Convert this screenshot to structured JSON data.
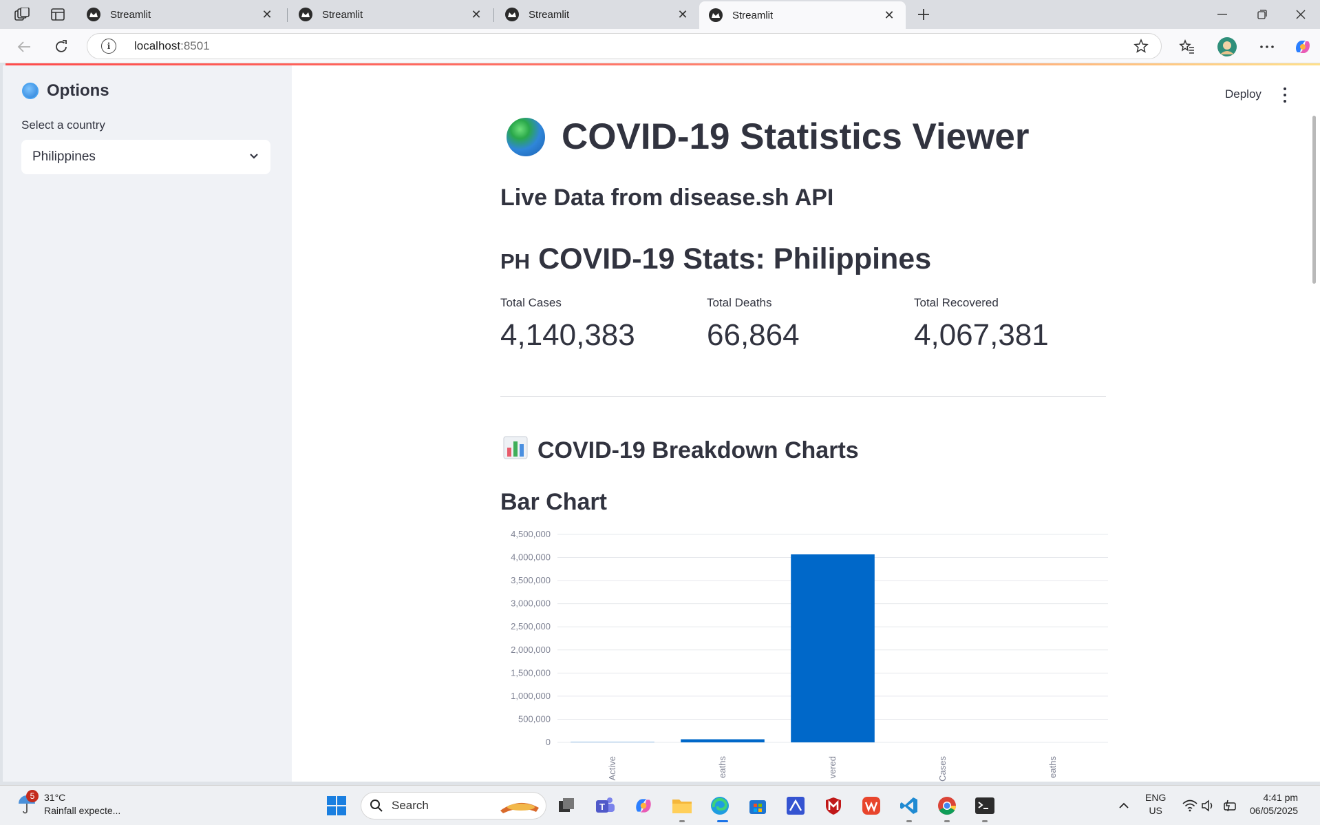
{
  "browser": {
    "tabs": [
      {
        "title": "Streamlit",
        "active": false
      },
      {
        "title": "Streamlit",
        "active": false
      },
      {
        "title": "Streamlit",
        "active": false
      },
      {
        "title": "Streamlit",
        "active": true
      }
    ],
    "url_host": "localhost",
    "url_port": ":8501"
  },
  "sidebar": {
    "title": "Options",
    "select_label": "Select a country",
    "select_value": "Philippines"
  },
  "header": {
    "deploy_label": "Deploy"
  },
  "main": {
    "title": "COVID-19 Statistics Viewer",
    "subtitle": "Live Data from disease.sh API",
    "stats_flag": "PH",
    "stats_heading": "COVID-19 Stats: Philippines",
    "metrics": [
      {
        "label": "Total Cases",
        "value": "4,140,383"
      },
      {
        "label": "Total Deaths",
        "value": "66,864"
      },
      {
        "label": "Total Recovered",
        "value": "4,067,381"
      }
    ],
    "charts_heading": "COVID-19 Breakdown Charts",
    "bar_heading": "Bar Chart"
  },
  "chart_data": {
    "type": "bar",
    "categories": [
      "Active",
      "Deaths",
      "Recovered",
      "Today Cases",
      "Today Deaths"
    ],
    "category_labels_visible": [
      "Active",
      "eaths",
      "vered",
      "Cases",
      "eaths"
    ],
    "values": [
      6138,
      66864,
      4067381,
      0,
      0
    ],
    "ylim": [
      0,
      4500000
    ],
    "yticks": [
      0,
      500000,
      1000000,
      1500000,
      2000000,
      2500000,
      3000000,
      3500000,
      4000000,
      4500000
    ],
    "ytick_labels": [
      "0",
      "500,000",
      "1,000,000",
      "1,500,000",
      "2,000,000",
      "2,500,000",
      "3,000,000",
      "3,500,000",
      "4,000,000",
      "4,500,000"
    ],
    "grid": true,
    "color": "#0068c9"
  },
  "taskbar": {
    "weather_badge": "5",
    "weather_temp": "31°C",
    "weather_desc": "Rainfall expecte...",
    "search_label": "Search",
    "lang_top": "ENG",
    "lang_bottom": "US",
    "time": "4:41 pm",
    "date": "06/05/2025"
  }
}
